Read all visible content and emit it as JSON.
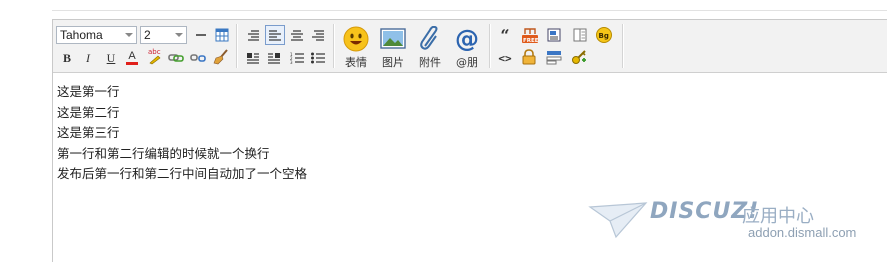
{
  "toolbar": {
    "font_name": "Tahoma",
    "font_size": "2",
    "big_buttons": {
      "emoticon": "表情",
      "image": "图片",
      "attachment": "附件",
      "mention": "@朋"
    },
    "small_labels": {
      "bold": "B",
      "italic": "I",
      "underline": "U",
      "font_color": "A",
      "spellcheck": "abc",
      "quote": "“",
      "code": "<>",
      "bg": "Bg",
      "free": "FREE"
    }
  },
  "content": {
    "lines": [
      "这是第一行",
      "这是第二行",
      "这是第三行",
      "第一行和第二行编辑的时候就一个换行",
      "发布后第一行和第二行中间自动加了一个空格"
    ]
  },
  "watermark": {
    "brand": "DISCUZ!",
    "chinese": "应用中心",
    "url": "addon.dismall.com"
  },
  "colors": {
    "toolbar_bg": "#f2f2f2",
    "border": "#c9c9c9",
    "watermark": "#8fa6bf",
    "active_border": "#7a9ccc"
  }
}
